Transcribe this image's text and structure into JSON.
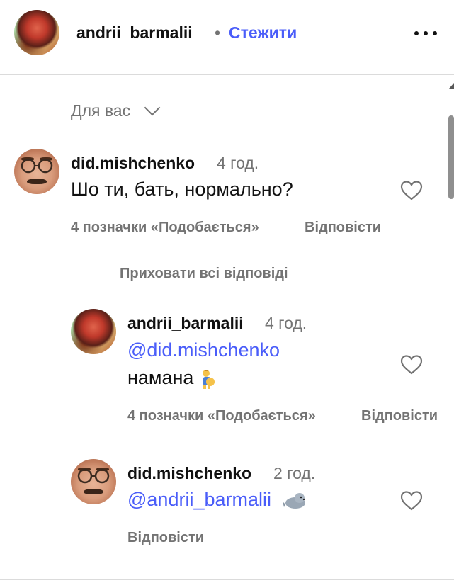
{
  "header": {
    "username": "andrii_barmalii",
    "separator": "•",
    "follow_label": "Стежити",
    "more_icon": "more-horizontal-icon"
  },
  "filter": {
    "label": "Для вас",
    "icon": "chevron-down-icon"
  },
  "comment": {
    "username": "did.mishchenko",
    "time": "4 год.",
    "text": "Шо ти, бать, нормально?",
    "likes": "4 позначки «Подобається»",
    "reply_label": "Відповісти"
  },
  "replies_toggle": "Приховати всі відповіді",
  "replies": [
    {
      "username": "andrii_barmalii",
      "time": "4 год.",
      "mention": "@did.mishchenko",
      "text": "намана",
      "emoji": "pregnant-man-emoji",
      "likes": "4 позначки «Подобається»",
      "reply_label": "Відповісти"
    },
    {
      "username": "did.mishchenko",
      "time": "2 год.",
      "mention": "@andrii_barmalii",
      "emoji": "seal-emoji",
      "reply_label": "Відповісти"
    }
  ],
  "colors": {
    "accent": "#4a5df9",
    "muted": "#737373",
    "text": "#111111"
  }
}
